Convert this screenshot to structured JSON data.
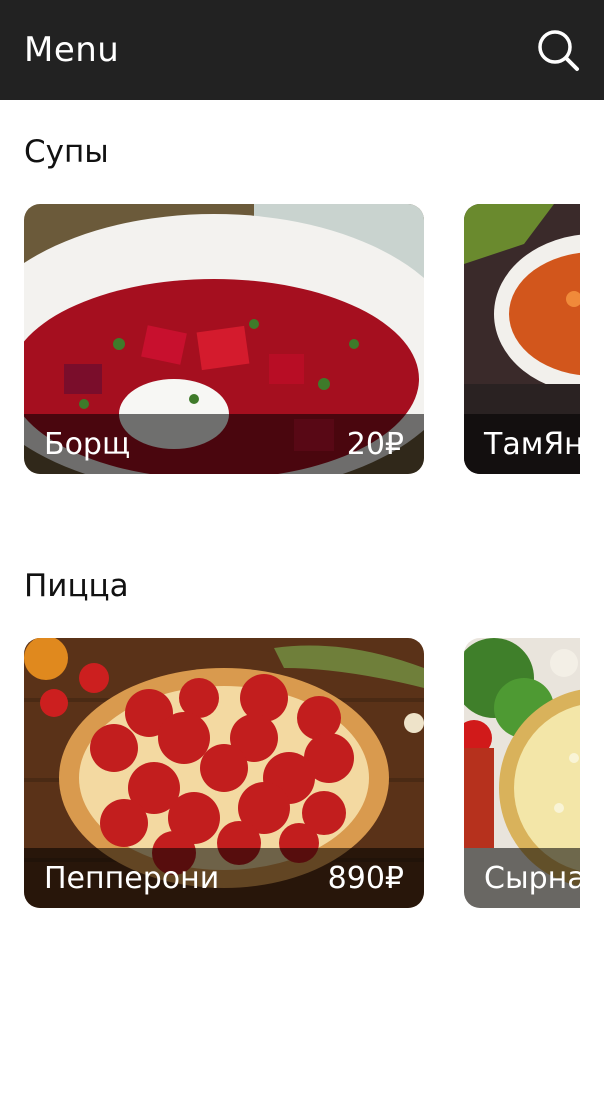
{
  "appbar": {
    "title": "Menu",
    "search_icon": "search-icon",
    "bg": "#222222"
  },
  "sections": [
    {
      "title": "Супы",
      "items": [
        {
          "name": "Борщ",
          "price": "20₽",
          "image": "borscht-photo"
        },
        {
          "name": "ТамЯн",
          "price": "",
          "image": "tom-yum-photo"
        }
      ]
    },
    {
      "title": "Пицца",
      "items": [
        {
          "name": "Пепперони",
          "price": "890₽",
          "image": "pepperoni-pizza-photo"
        },
        {
          "name": "Сырна",
          "price": "",
          "image": "cheese-pizza-photo"
        }
      ]
    }
  ]
}
